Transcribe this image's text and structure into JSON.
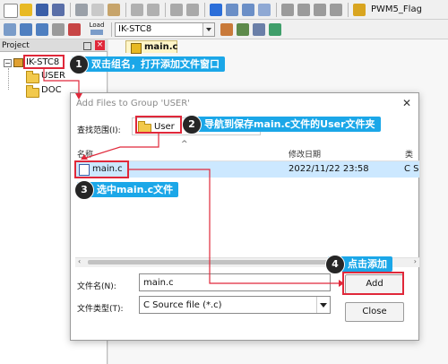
{
  "toolbar": {
    "target_name": "PWM5_Flag",
    "load_label": "Load",
    "project_combo": "IK-STC8"
  },
  "panel": {
    "title": "Project",
    "root": "IK-STC8",
    "groups": [
      "USER",
      "DOC"
    ]
  },
  "editor": {
    "tab": "main.c"
  },
  "dialog": {
    "title": "Add Files to Group 'USER'",
    "lookin_label": "查找范围(I):",
    "lookin_value": "User",
    "col_name": "名称",
    "col_date": "修改日期",
    "col_type": "类",
    "file_name": "main.c",
    "file_date": "2022/11/22 23:58",
    "file_type": "C S",
    "filename_label": "文件名(N):",
    "filename_value": "main.c",
    "filetype_label": "文件类型(T):",
    "filetype_value": "C Source file (*.c)",
    "add_label": "Add",
    "close_label": "Close"
  },
  "annotations": {
    "s1": {
      "num": "1",
      "text": "双击组名，打开添加文件窗口"
    },
    "s2": {
      "num": "2",
      "text": "导航到保存main.c文件的User文件夹"
    },
    "s3": {
      "num": "3",
      "text": "选中main.c文件"
    },
    "s4": {
      "num": "4",
      "text": "点击添加"
    }
  },
  "colors": {
    "annotation_bg": "#1ba7e8",
    "highlight_red": "#e0283a",
    "folder": "#f2c94c"
  }
}
